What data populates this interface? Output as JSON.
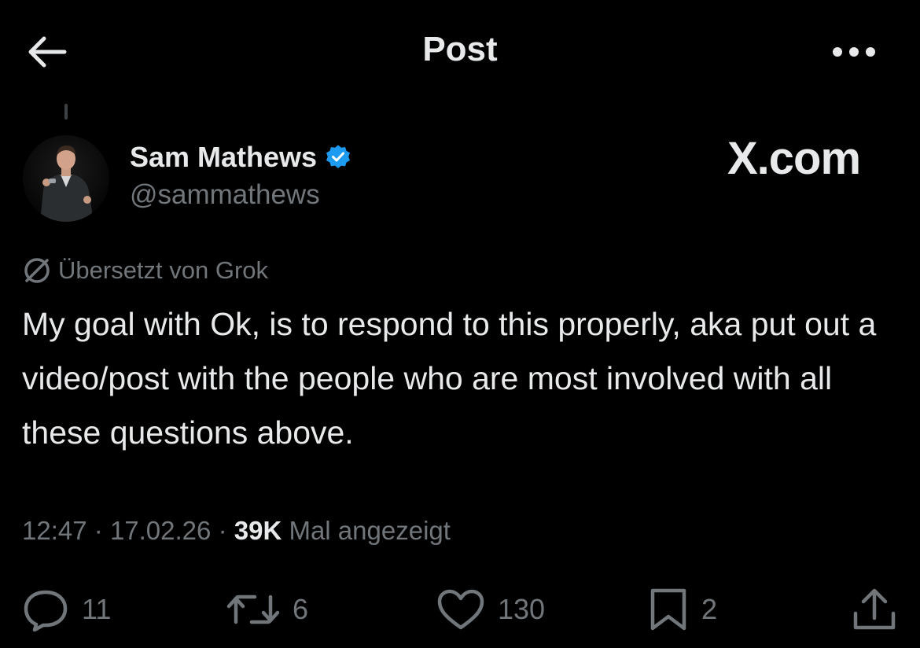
{
  "header": {
    "title": "Post",
    "back_icon": "arrow-left-icon",
    "more_icon": "more-horizontal-icon"
  },
  "author": {
    "display_name": "Sam Mathews",
    "handle": "@sammathews",
    "verified": true,
    "verified_color": "#1d9bf0"
  },
  "watermark": "X.com",
  "translation": {
    "label": "Übersetzt von Grok",
    "icon": "grok-icon"
  },
  "post": {
    "text": "My goal with Ok, is to respond to this properly, aka put out a video/post with the people who are most involved with all these questions above."
  },
  "meta": {
    "time": "12:47",
    "separator": "·",
    "date": "17.02.26",
    "views_count": "39K",
    "views_label": "Mal angezeigt"
  },
  "actions": {
    "replies": "11",
    "reposts": "6",
    "likes": "130",
    "bookmarks": "2"
  },
  "colors": {
    "background": "#000000",
    "text_primary": "#e7e9ea",
    "text_secondary": "#71767b"
  }
}
